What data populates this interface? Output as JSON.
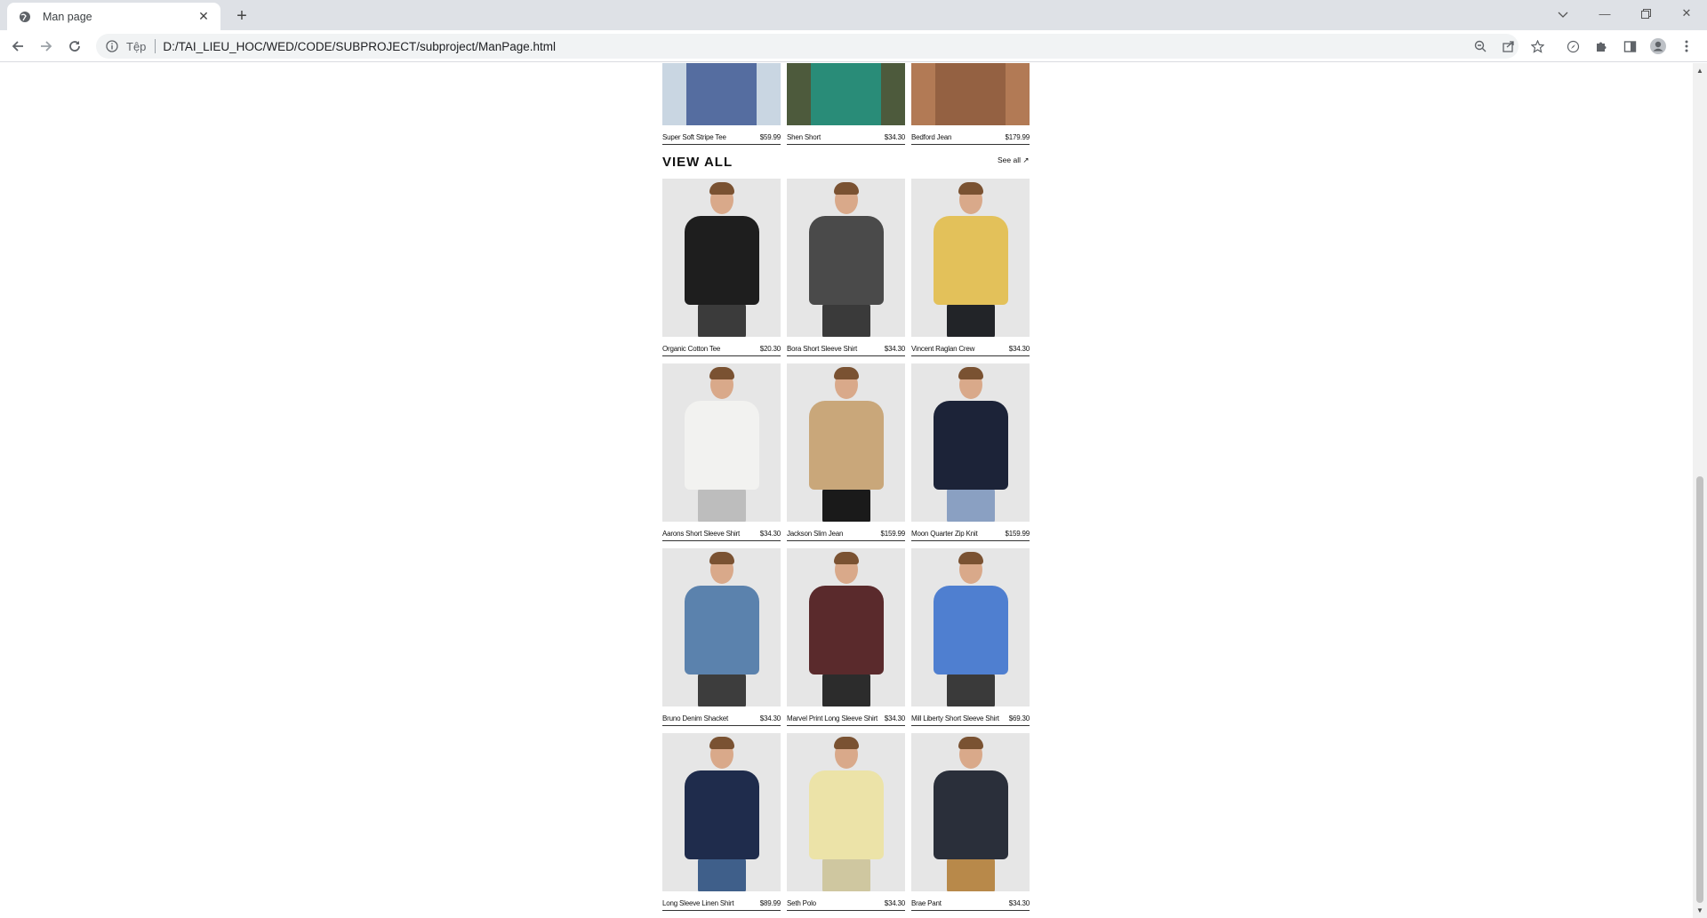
{
  "browser": {
    "tab_title": "Man page",
    "omnibox_chip": "Tệp",
    "url": "D:/TAI_LIEU_HOC/WED/CODE/SUBPROJECT/subproject/ManPage.html"
  },
  "top_products": [
    {
      "name": "Super Soft Stripe Tee",
      "price": "$59.99",
      "colors": {
        "bg": "#c9d6e2",
        "torso": "#2d4a8a"
      }
    },
    {
      "name": "Shen Short",
      "price": "$34.30",
      "colors": {
        "bg": "#4d5a3c",
        "torso": "#1d9e8c"
      }
    },
    {
      "name": "Bedford Jean",
      "price": "$179.99",
      "colors": {
        "bg": "#b27a55",
        "torso": "#8a5a3c"
      }
    }
  ],
  "section": {
    "title": "VIEW ALL",
    "see_all": "See all ↗"
  },
  "products": [
    {
      "name": "Organic Cotton Tee",
      "price": "$20.30",
      "colors": {
        "torso": "#1e1e1e",
        "legs": "#3b3b3b"
      }
    },
    {
      "name": "Bora Short Sleeve Shirt",
      "price": "$34.30",
      "colors": {
        "torso": "#4a4a4a",
        "legs": "#3a3a3a"
      }
    },
    {
      "name": "Vincent Raglan Crew",
      "price": "$34.30",
      "colors": {
        "torso": "#e3c15a",
        "legs": "#222428"
      }
    },
    {
      "name": "Aarons Short Sleeve Shirt",
      "price": "$34.30",
      "colors": {
        "torso": "#f2f2f0",
        "legs": "#bdbdbd"
      }
    },
    {
      "name": "Jackson Slim Jean",
      "price": "$159.99",
      "colors": {
        "torso": "#c9a77a",
        "legs": "#1a1a1a"
      }
    },
    {
      "name": "Moon Quarter Zip Knit",
      "price": "$159.99",
      "colors": {
        "torso": "#1c2338",
        "legs": "#8aa0c2"
      }
    },
    {
      "name": "Bruno Denim Shacket",
      "price": "$34.30",
      "colors": {
        "torso": "#5b82ad",
        "legs": "#3d3d3d"
      }
    },
    {
      "name": "Marvel Print Long Sleeve Shirt",
      "price": "$34.30",
      "colors": {
        "torso": "#5a2a2c",
        "legs": "#2c2c2c"
      }
    },
    {
      "name": "Mill Liberty Short Sleeve Shirt",
      "price": "$69.30",
      "colors": {
        "torso": "#4f7fd0",
        "legs": "#3a3a3a"
      }
    },
    {
      "name": "Long Sleeve Linen Shirt",
      "price": "$89.99",
      "colors": {
        "torso": "#1f2c4c",
        "legs": "#3f5f8a"
      }
    },
    {
      "name": "Seth Polo",
      "price": "$34.30",
      "colors": {
        "torso": "#ece3a8",
        "legs": "#cfc7a0"
      }
    },
    {
      "name": "Brae Pant",
      "price": "$34.30",
      "colors": {
        "torso": "#2a2f3a",
        "legs": "#b8894a"
      }
    }
  ]
}
